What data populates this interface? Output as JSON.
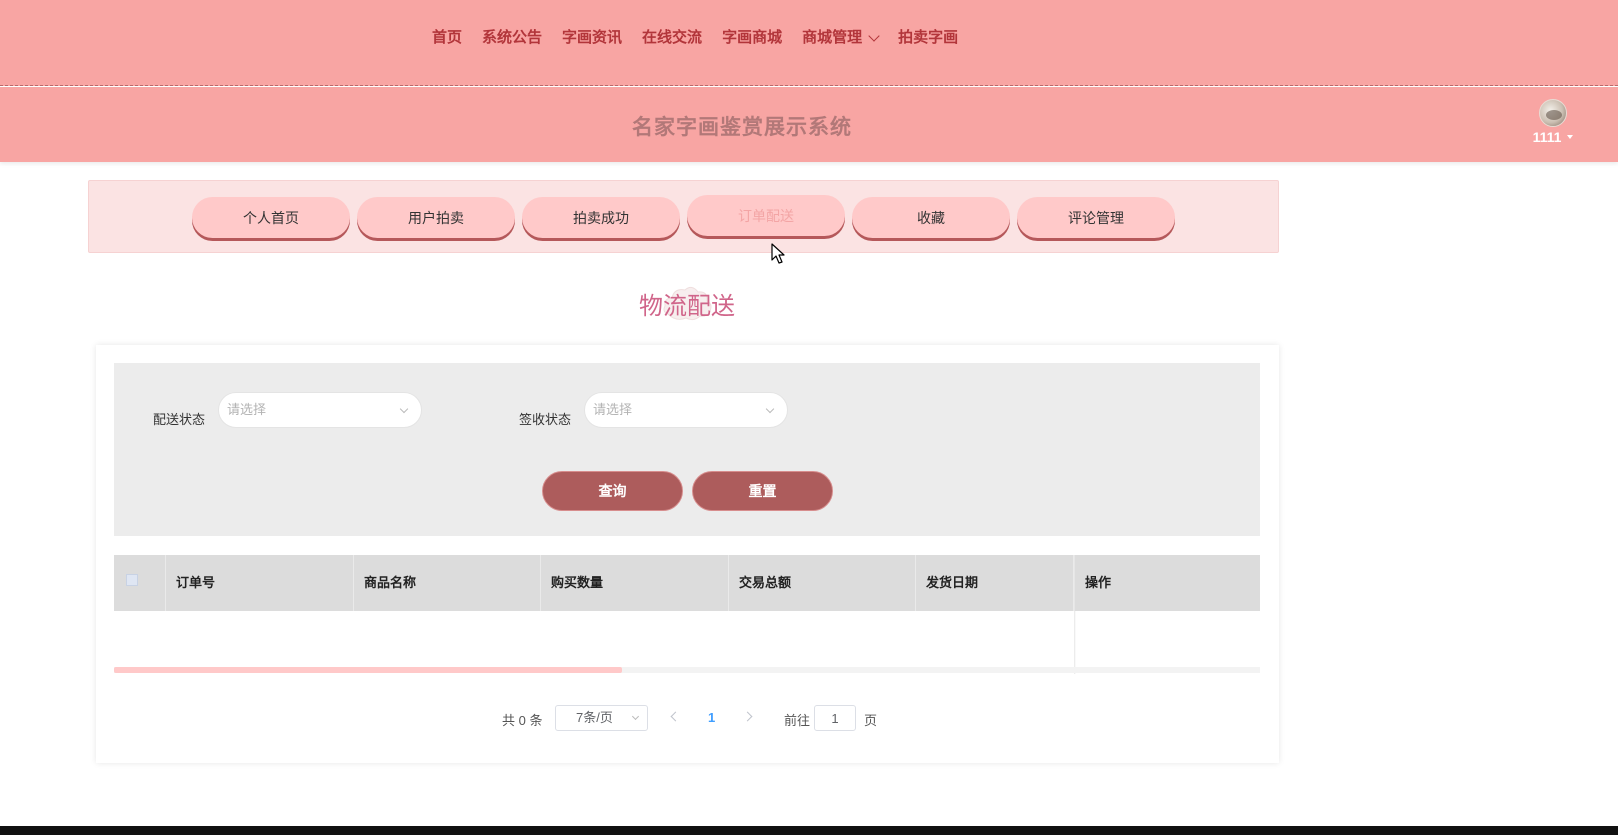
{
  "nav": {
    "items": [
      {
        "label": "首页"
      },
      {
        "label": "系统公告"
      },
      {
        "label": "字画资讯"
      },
      {
        "label": "在线交流"
      },
      {
        "label": "字画商城"
      },
      {
        "label": "商城管理"
      },
      {
        "label": "拍卖字画"
      }
    ]
  },
  "header": {
    "site_title": "名家字画鉴赏展示系统",
    "user_name": "1111"
  },
  "tabs": [
    {
      "label": "个人首页"
    },
    {
      "label": "用户拍卖"
    },
    {
      "label": "拍卖成功"
    },
    {
      "label": "订单配送"
    },
    {
      "label": "收藏"
    },
    {
      "label": "评论管理"
    }
  ],
  "active_tab": "订单配送",
  "section": {
    "title": "物流配送"
  },
  "filters": {
    "delivery_status_label": "配送状态",
    "delivery_status_placeholder": "请选择",
    "receipt_status_label": "签收状态",
    "receipt_status_placeholder": "请选择",
    "query_button": "查询",
    "reset_button": "重置"
  },
  "table": {
    "columns": [
      "订单号",
      "商品名称",
      "购买数量",
      "交易总额",
      "发货日期",
      "操作"
    ],
    "rows": []
  },
  "pagination": {
    "total_prefix": "共",
    "total_count": "0",
    "total_suffix": "条",
    "page_size": "7条/页",
    "current_page": "1",
    "goto_label": "前往",
    "goto_value": "1",
    "page_unit": "页"
  },
  "colors": {
    "header_bg": "#f8a5a3",
    "nav_text": "#b2353a",
    "tab_bg": "#ffc9c9",
    "button_bg": "#ad5c5c",
    "section_title": "#d0658a"
  }
}
